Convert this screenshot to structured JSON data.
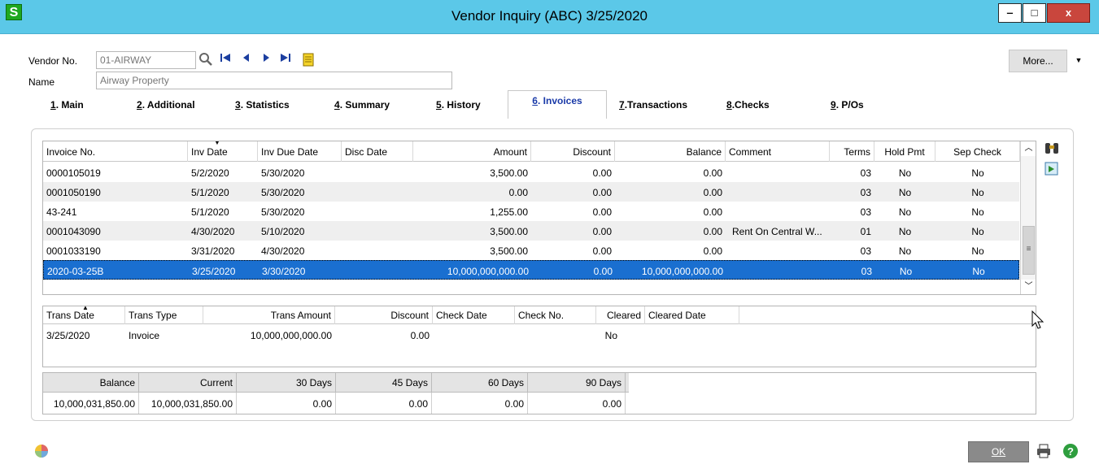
{
  "window": {
    "title": "Vendor Inquiry (ABC) 3/25/2020",
    "app_icon": "S",
    "minimize": "‒",
    "maximize": "□",
    "close": "x"
  },
  "header": {
    "vendor_label": "Vendor No.",
    "vendor_value": "01-AIRWAY",
    "name_label": "Name",
    "name_value": "Airway Property",
    "more_label": "More...",
    "icons": [
      "search-icon",
      "first-record-icon",
      "previous-record-icon",
      "next-record-icon",
      "last-record-icon",
      "notes-icon"
    ]
  },
  "tabs": [
    {
      "num": "1",
      "label": ". Main"
    },
    {
      "num": "2",
      "label": ". Additional"
    },
    {
      "num": "3",
      "label": ". Statistics"
    },
    {
      "num": "4",
      "label": ". Summary"
    },
    {
      "num": "5",
      "label": ". History"
    },
    {
      "num": "6",
      "label": ". Invoices"
    },
    {
      "num": "7",
      "label": ".Transactions"
    },
    {
      "num": "8",
      "label": ".Checks"
    },
    {
      "num": "9",
      "label": ". P/Os"
    }
  ],
  "invoices": {
    "columns": [
      "Invoice No.",
      "Inv Date",
      "Inv Due Date",
      "Disc Date",
      "Amount",
      "Discount",
      "Balance",
      "Comment",
      "Terms",
      "Hold Pmt",
      "Sep Check"
    ],
    "rows": [
      [
        "0000105019",
        "5/2/2020",
        "5/30/2020",
        "",
        "3,500.00",
        "0.00",
        "0.00",
        "",
        "03",
        "No",
        "No"
      ],
      [
        "0001050190",
        "5/1/2020",
        "5/30/2020",
        "",
        "0.00",
        "0.00",
        "0.00",
        "",
        "03",
        "No",
        "No"
      ],
      [
        "43-241",
        "5/1/2020",
        "5/30/2020",
        "",
        "1,255.00",
        "0.00",
        "0.00",
        "",
        "03",
        "No",
        "No"
      ],
      [
        "0001043090",
        "4/30/2020",
        "5/10/2020",
        "",
        "3,500.00",
        "0.00",
        "0.00",
        "Rent On Central W...",
        "01",
        "No",
        "No"
      ],
      [
        "0001033190",
        "3/31/2020",
        "4/30/2020",
        "",
        "3,500.00",
        "0.00",
        "0.00",
        "",
        "03",
        "No",
        "No"
      ],
      [
        "2020-03-25B",
        "3/25/2020",
        "3/30/2020",
        "",
        "10,000,000,000.00",
        "0.00",
        "10,000,000,000.00",
        "",
        "03",
        "No",
        "No"
      ]
    ],
    "selected_row": 5
  },
  "transactions": {
    "columns": [
      "Trans Date",
      "Trans Type",
      "Trans Amount",
      "Discount",
      "Check Date",
      "Check No.",
      "Cleared",
      "Cleared Date"
    ],
    "rows": [
      [
        "3/25/2020",
        "Invoice",
        "10,000,000,000.00",
        "0.00",
        "",
        "",
        "No",
        ""
      ]
    ]
  },
  "aging": {
    "columns": [
      "Balance",
      "Current",
      "30 Days",
      "45 Days",
      "60 Days",
      "90 Days"
    ],
    "values": [
      "10,000,031,850.00",
      "10,000,031,850.00",
      "0.00",
      "0.00",
      "0.00",
      "0.00"
    ]
  },
  "footer": {
    "ok_label": "OK"
  },
  "colors": {
    "titlebar": "#5bc8e8",
    "selected_row": "#1a6fd0",
    "active_tab_text": "#1a3aa8"
  }
}
